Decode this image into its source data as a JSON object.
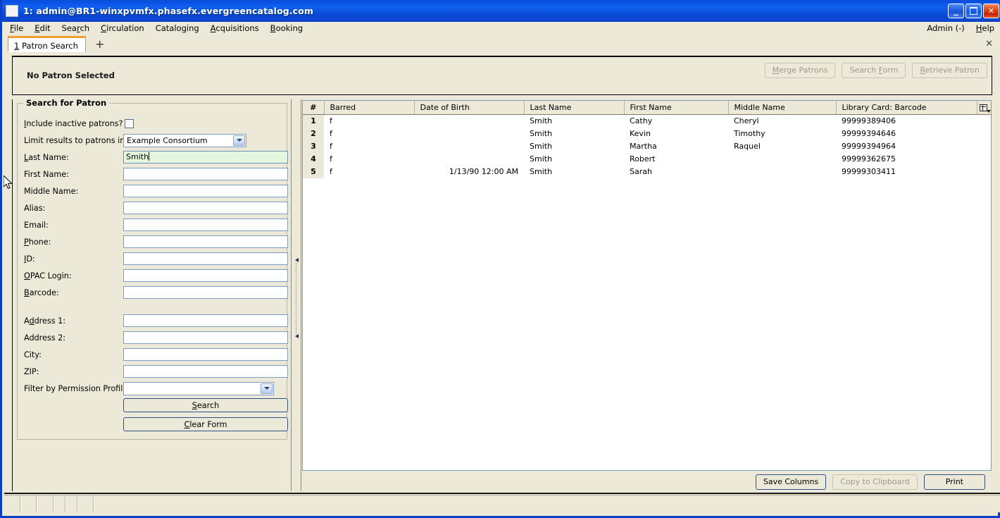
{
  "window": {
    "title": "1: admin@BR1-winxpvmfx.phasefx.evergreencatalog.com",
    "minimize_label": "_",
    "maximize_label": "",
    "close_label": "✕"
  },
  "menubar": {
    "items": [
      {
        "label": "File",
        "accel": "F"
      },
      {
        "label": "Edit",
        "accel": "E"
      },
      {
        "label": "Search",
        "accel": "r"
      },
      {
        "label": "Circulation",
        "accel": "C"
      },
      {
        "label": "Cataloging",
        "accel": "g"
      },
      {
        "label": "Acquisitions",
        "accel": "A"
      },
      {
        "label": "Booking",
        "accel": "B"
      }
    ],
    "right_items": [
      {
        "label": "Admin (-)"
      },
      {
        "label": "Help",
        "accel": "H"
      }
    ]
  },
  "tabbar": {
    "tabs": [
      {
        "number": "1",
        "label": "Patron Search"
      }
    ],
    "new_tab_label": "+",
    "close_all_label": "✕"
  },
  "patron_header": {
    "title": "No Patron Selected",
    "buttons": [
      {
        "label": "Merge Patrons",
        "disabled": true
      },
      {
        "label": "Search Form",
        "disabled": true
      },
      {
        "label": "Retrieve Patron",
        "disabled": true
      }
    ]
  },
  "search_form": {
    "legend": "Search for Patron",
    "fields": [
      {
        "label": "Include inactive patrons?",
        "type": "checkbox",
        "checked": false,
        "value": ""
      },
      {
        "label": "Limit results to patrons in",
        "type": "select",
        "value": "Example Consortium"
      },
      {
        "label": "Last Name:",
        "type": "text",
        "value": "Smith",
        "focused": true
      },
      {
        "label": "First Name:",
        "type": "text",
        "value": ""
      },
      {
        "label": "Middle Name:",
        "type": "text",
        "value": ""
      },
      {
        "label": "Alias:",
        "type": "text",
        "value": ""
      },
      {
        "label": "Email:",
        "type": "text",
        "value": ""
      },
      {
        "label": "Phone:",
        "type": "text",
        "value": ""
      },
      {
        "label": "ID:",
        "type": "text",
        "value": ""
      },
      {
        "label": "OPAC Login:",
        "type": "text",
        "value": ""
      },
      {
        "label": "Barcode:",
        "type": "text",
        "value": ""
      },
      {
        "label": "Address 1:",
        "type": "text",
        "value": ""
      },
      {
        "label": "Address 2:",
        "type": "text",
        "value": ""
      },
      {
        "label": "City:",
        "type": "text",
        "value": ""
      },
      {
        "label": "ZIP:",
        "type": "text",
        "value": ""
      },
      {
        "label": "Filter by Permission Profile:",
        "type": "select",
        "value": ""
      }
    ],
    "buttons": [
      {
        "label": "Search"
      },
      {
        "label": "Clear Form"
      }
    ]
  },
  "results": {
    "columns": [
      "#",
      "Barred",
      "Date of Birth",
      "Last Name",
      "First Name",
      "Middle Name",
      "Library Card: Barcode"
    ],
    "rows": [
      {
        "num": "1",
        "barred": "f",
        "dob": "",
        "last": "Smith",
        "first": "Cathy",
        "middle": "Cheryl",
        "barcode": "99999389406"
      },
      {
        "num": "2",
        "barred": "f",
        "dob": "",
        "last": "Smith",
        "first": "Kevin",
        "middle": "Timothy",
        "barcode": "99999394646"
      },
      {
        "num": "3",
        "barred": "f",
        "dob": "",
        "last": "Smith",
        "first": "Martha",
        "middle": "Raquel",
        "barcode": "99999394964"
      },
      {
        "num": "4",
        "barred": "f",
        "dob": "",
        "last": "Smith",
        "first": "Robert",
        "middle": "",
        "barcode": "99999362675"
      },
      {
        "num": "5",
        "barred": "f",
        "dob": "1/13/90 12:00 AM",
        "last": "Smith",
        "first": "Sarah",
        "middle": "",
        "barcode": "99999303411"
      }
    ],
    "buttons": [
      {
        "label": "Save Columns",
        "disabled": false
      },
      {
        "label": "Copy to Clipboard",
        "disabled": true
      },
      {
        "label": "Print",
        "disabled": false
      }
    ]
  },
  "statusbar": {
    "segments": [
      "",
      "",
      "",
      "",
      "",
      "",
      ""
    ]
  },
  "colors": {
    "titlebar_blue": "#0b55e8",
    "window_border": "#0a40c8",
    "face": "#ece9d8",
    "tab_accent": "#f0a030",
    "focus_field": "#e4f7de",
    "field_border": "#7e9cc0"
  }
}
